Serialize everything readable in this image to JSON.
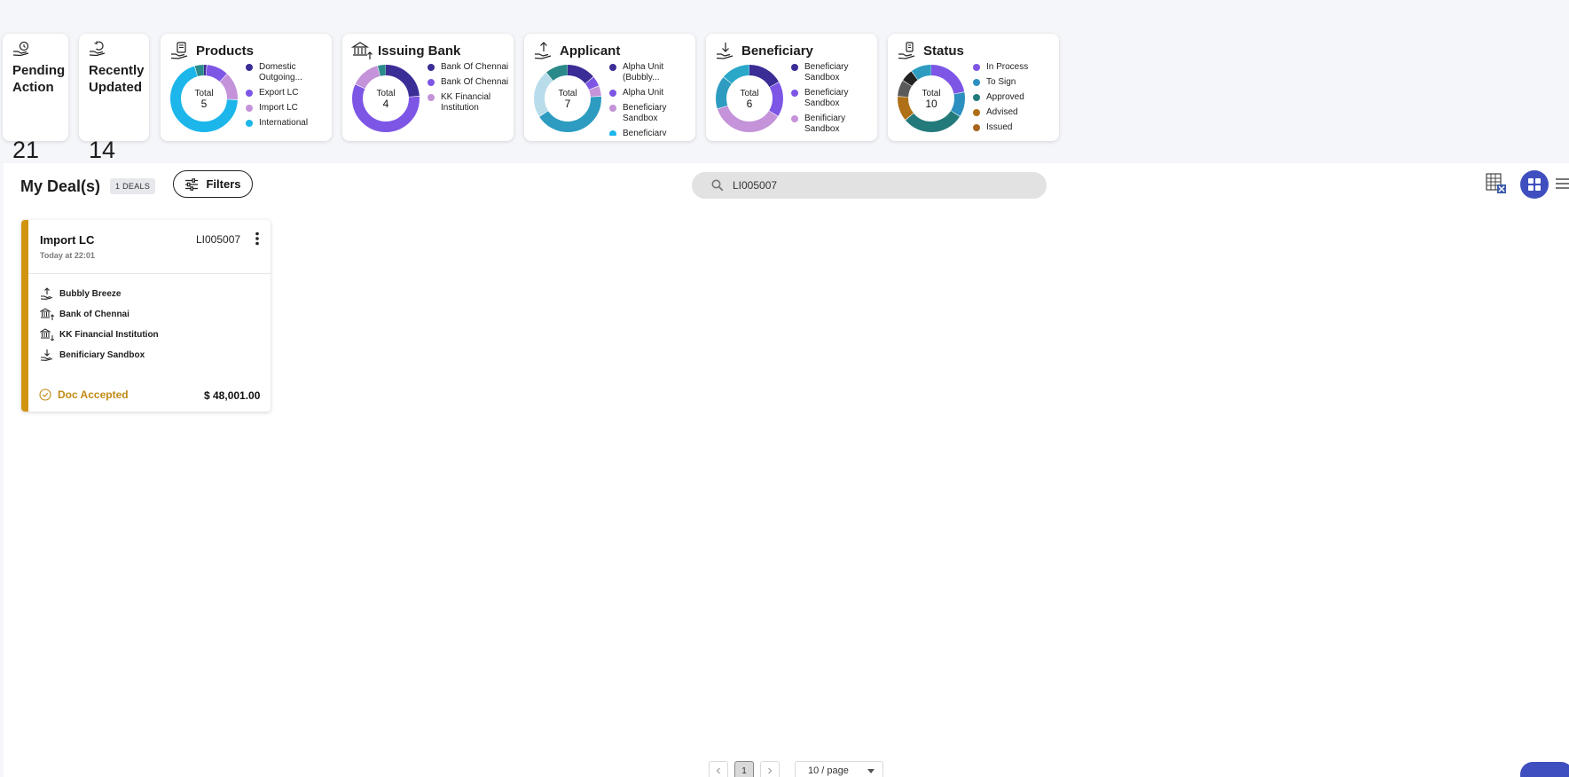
{
  "stats": [
    {
      "title": "Pending Action",
      "value": "21"
    },
    {
      "title": "Recently Updated",
      "value": "14"
    }
  ],
  "charts": [
    {
      "title": "Products",
      "total_label": "Total",
      "total": "5",
      "legend": [
        {
          "label": "Domestic Outgoing...",
          "color": "#3a2d96"
        },
        {
          "label": "Export LC",
          "color": "#7d56e6"
        },
        {
          "label": "Import LC",
          "color": "#c493d9"
        },
        {
          "label": "International",
          "color": "#1cb6ea"
        }
      ],
      "segments": [
        {
          "value": 1,
          "color": "#3a2d96"
        },
        {
          "value": 7,
          "color": "#7d56e6"
        },
        {
          "value": 9,
          "color": "#c493d9"
        },
        {
          "value": 46,
          "color": "#1cb6ea"
        },
        {
          "value": 3,
          "color": "#2a8a8a"
        }
      ]
    },
    {
      "title": "Issuing Bank",
      "total_label": "Total",
      "total": "4",
      "legend": [
        {
          "label": "Bank Of Chennai",
          "color": "#3a2d96"
        },
        {
          "label": "Bank Of Chennai",
          "color": "#7d56e6"
        },
        {
          "label": "KK Financial Institution",
          "color": "#c493d9"
        }
      ],
      "segments": [
        {
          "value": 24,
          "color": "#3a2d96"
        },
        {
          "value": 58,
          "color": "#7d56e6"
        },
        {
          "value": 14,
          "color": "#c493d9"
        },
        {
          "value": 4,
          "color": "#2a8a8a"
        }
      ]
    },
    {
      "title": "Applicant",
      "total_label": "Total",
      "total": "7",
      "legend": [
        {
          "label": "Alpha Unit (Bubbly...",
          "color": "#3a2d96"
        },
        {
          "label": "Alpha Unit",
          "color": "#7d56e6"
        },
        {
          "label": "Beneficiary Sandbox",
          "color": "#c493d9"
        },
        {
          "label": "Beneficiary",
          "color": "#1cb6ea"
        }
      ],
      "segments": [
        {
          "value": 14,
          "color": "#3a2d96"
        },
        {
          "value": 5,
          "color": "#7d56e6"
        },
        {
          "value": 5,
          "color": "#c493d9"
        },
        {
          "value": 42,
          "color": "#2d9cc0"
        },
        {
          "value": 23,
          "color": "#b8dcea"
        },
        {
          "value": 11,
          "color": "#2a8a8a"
        }
      ]
    },
    {
      "title": "Beneficiary",
      "total_label": "Total",
      "total": "6",
      "legend": [
        {
          "label": "Beneficiary Sandbox",
          "color": "#3a2d96"
        },
        {
          "label": "Beneficiary Sandbox",
          "color": "#7d56e6"
        },
        {
          "label": "Benificiary Sandbox",
          "color": "#c493d9"
        }
      ],
      "segments": [
        {
          "value": 17,
          "color": "#3a2d96"
        },
        {
          "value": 17,
          "color": "#7d56e6"
        },
        {
          "value": 36,
          "color": "#c493d9"
        },
        {
          "value": 16,
          "color": "#2d9cc0"
        },
        {
          "value": 14,
          "color": "#2aa8c8"
        }
      ]
    },
    {
      "title": "Status",
      "total_label": "Total",
      "total": "10",
      "legend": [
        {
          "label": "In Process",
          "color": "#7d56e6"
        },
        {
          "label": "To Sign",
          "color": "#2d8fc0"
        },
        {
          "label": "Approved",
          "color": "#237a7a"
        },
        {
          "label": "Advised",
          "color": "#b07018"
        },
        {
          "label": "Issued",
          "color": "#a8651f"
        }
      ],
      "segments": [
        {
          "value": 22,
          "color": "#7d56e6"
        },
        {
          "value": 12,
          "color": "#2d8fc0"
        },
        {
          "value": 30,
          "color": "#237a7a"
        },
        {
          "value": 12,
          "color": "#b07018"
        },
        {
          "value": 8,
          "color": "#5a5a5a"
        },
        {
          "value": 6,
          "color": "#222222"
        },
        {
          "value": 10,
          "color": "#2d9cc0"
        }
      ]
    }
  ],
  "deals": {
    "title": "My Deal(s)",
    "badge": "1 DEALS",
    "filters_label": "Filters",
    "search_value": "LI005007",
    "card": {
      "type": "Import LC",
      "ref": "LI005007",
      "time": "Today at 22:01",
      "applicant": "Bubbly Breeze",
      "issuing_bank": "Bank of Chennai",
      "advising_bank": "KK Financial Institution",
      "beneficiary": "Benificiary Sandbox",
      "status": "Doc Accepted",
      "amount": "$ 48,001.00"
    }
  },
  "pagination": {
    "current_page": "1",
    "page_size": "10 / page"
  },
  "colors": {
    "accent": "#3f4fbf",
    "status_doc_accepted": "#c08a14"
  }
}
